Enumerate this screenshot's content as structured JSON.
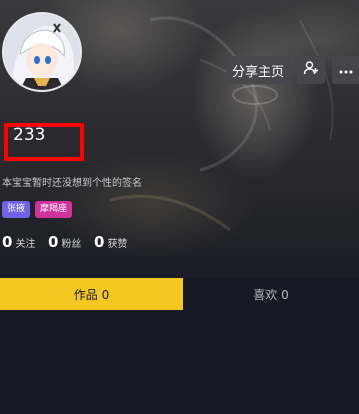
{
  "header": {
    "actions": {
      "share_label": "分享主页"
    }
  },
  "profile": {
    "nickname": "233",
    "bio": "本宝宝暂时还没想到个性的签名",
    "tags": [
      {
        "label": "张掖",
        "color": "#6f63e8"
      },
      {
        "label": "摩羯座",
        "color": "#d0339b"
      }
    ],
    "stats": [
      {
        "value": "0",
        "label": "关注"
      },
      {
        "value": "0",
        "label": "粉丝"
      },
      {
        "value": "0",
        "label": "获赞"
      }
    ]
  },
  "tabs": [
    {
      "label": "作品 0",
      "active": true
    },
    {
      "label": "喜欢 0",
      "active": false
    }
  ],
  "colors": {
    "accent_yellow": "#f3c820",
    "highlight_red": "#ff0000",
    "background": "#161823"
  }
}
